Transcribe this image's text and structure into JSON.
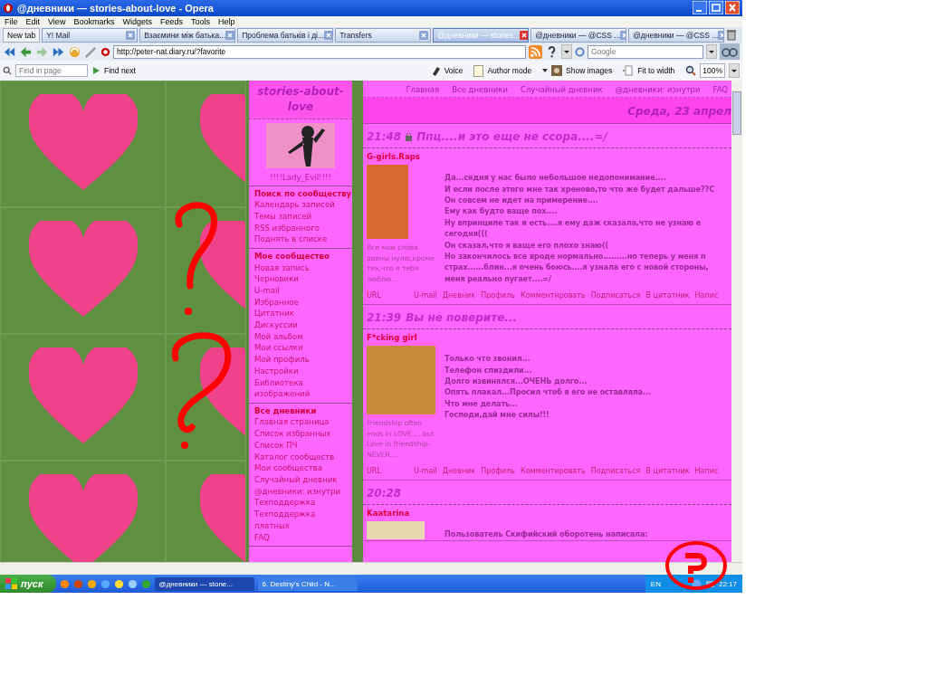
{
  "window": {
    "title": "@дневники — stories-about-love - Opera"
  },
  "menu": [
    "File",
    "Edit",
    "View",
    "Bookmarks",
    "Widgets",
    "Feeds",
    "Tools",
    "Help"
  ],
  "new_tab": "New tab",
  "tabs": [
    {
      "label": "Y! Mail",
      "selected": false
    },
    {
      "label": "Взаємини між батька...",
      "selected": false
    },
    {
      "label": "Проблема батьків і ді...",
      "selected": false
    },
    {
      "label": "Transfers",
      "selected": false
    },
    {
      "label": "@дневники — stories...",
      "selected": true
    },
    {
      "label": "@дневники — @CSS ...",
      "selected": false
    },
    {
      "label": "@дневники — @CSS ...",
      "selected": false
    }
  ],
  "address": {
    "url": "http://peter-nat.diary.ru/?favorite",
    "search_placeholder": "Google"
  },
  "find_bar": {
    "placeholder": "Find in page",
    "find_next": "Find next",
    "tools": [
      {
        "kind": "voice",
        "label": "Voice"
      },
      {
        "kind": "author",
        "label": "Author mode"
      },
      {
        "kind": "images",
        "label": "Show images"
      },
      {
        "kind": "fit",
        "label": "Fit to width"
      }
    ],
    "zoom": "100%"
  },
  "sidebar": {
    "title": "stories-about-love",
    "user": "!!!!Lady_Evil!!!!",
    "sections": [
      {
        "heading": "Поиск по сообществу",
        "items": [
          "Календарь записей",
          "Темы записей",
          "RSS избранного",
          "Поднять в списке"
        ]
      },
      {
        "heading": "Мое сообщество",
        "items": [
          "Новая запись",
          "Черновики",
          "U-mail",
          "Избранное",
          "Цитатник",
          "Дискуссии",
          "Мой альбом",
          "Мои ссылки",
          "Мой профиль",
          "Настройки",
          "Библиотека изображений"
        ]
      },
      {
        "heading": "Все дневники",
        "items": [
          "Главная страница",
          "Список избранных",
          "Список ПЧ",
          "Каталог сообществ",
          "Мои сообщества",
          "Случайный дневник",
          "@дневники: изнутри",
          "Техподдержка",
          "Техподдержка платных",
          "FAQ"
        ]
      }
    ]
  },
  "nav": [
    "Главная",
    "Все дневники",
    "Случайный дневник",
    "@дневники: изнутри",
    "FAQ"
  ],
  "date": "Среда, 23 апрел",
  "posts": [
    {
      "time": "21:48",
      "pinned_icon": true,
      "title": "Ппц....и это еще не ссора....=/",
      "author": "G-girls.Raps",
      "signature": "Все мои слова равны нулю,кроме тех,что я тебя люблю...",
      "lines": [
        "Да...седня у нас было небольшое недопонимание....",
        "И если после этого мне так хреново,то что же будет дальше??С",
        "Он совсем не идет на примерение....",
        "Ему как будто ваще пох....",
        "Ну впринципе так и есть....я ему даж сказала,что не узнаю е",
        "сегодня(((",
        "Он сказал,что я ваще его плохо знаю((",
        "Но закончилось все вроде нормально.........но теперь у меня п",
        "страх......блин...я очень боюсь....я узнала его с новой стороны,",
        "меня реально пугает....=/"
      ],
      "actions": [
        "URL",
        "U-mail",
        "Дневник",
        "Профиль",
        "Комментировать",
        "Подписаться",
        "В цитатник",
        "Напис"
      ]
    },
    {
      "time": "21:39",
      "title": "Вы не поверите...",
      "author": "F*cking girl",
      "signature": "Friendship often ends in LOVE.....but Love in friendship-NEVER....",
      "lines": [
        "Только что звонил...",
        "Телефон спиздили...",
        "Долго извинялся...ОЧЕНЬ долго...",
        "Опять плакал...Просил чтоб я его не оставляла...",
        "Что мне делать...",
        "Господи,дай мне силы!!!"
      ],
      "actions": [
        "URL",
        "U-mail",
        "Дневник",
        "Профиль",
        "Комментировать",
        "Подписаться",
        "В цитатник",
        "Напис"
      ]
    },
    {
      "time": "20:28",
      "author": "Kaatarina",
      "lines": [
        "Пользователь **Скифийский оборотень** написала:"
      ]
    }
  ],
  "taskbar": {
    "start": "пуск",
    "tasks": [
      {
        "label": "@дневники — stone...",
        "selected": true
      },
      {
        "label": "6. Destiny's Child - N...",
        "selected": false
      }
    ],
    "language": "EN",
    "clock": "22:17"
  }
}
